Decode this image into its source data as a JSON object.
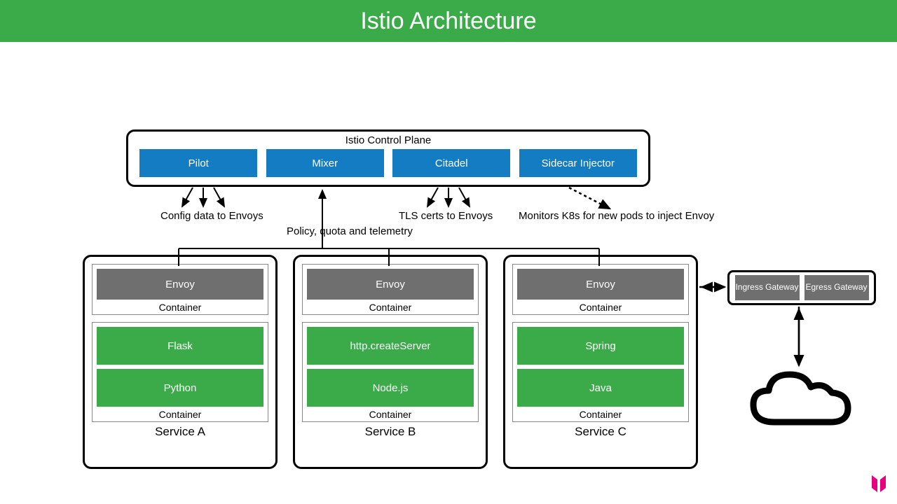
{
  "title": "Istio Architecture",
  "control_plane": {
    "label": "Istio Control Plane",
    "boxes": [
      "Pilot",
      "Mixer",
      "Citadel",
      "Sidecar Injector"
    ]
  },
  "annotations": {
    "pilot": "Config data to Envoys",
    "mixer": "Policy, quota and telemetry",
    "citadel": "TLS certs to Envoys",
    "sidecar": "Monitors K8s for new pods to inject Envoy"
  },
  "services": [
    {
      "name": "Service A",
      "envoy": "Envoy",
      "container_label": "Container",
      "app": [
        "Flask",
        "Python"
      ]
    },
    {
      "name": "Service B",
      "envoy": "Envoy",
      "container_label": "Container",
      "app": [
        "http.createServer",
        "Node.js"
      ]
    },
    {
      "name": "Service C",
      "envoy": "Envoy",
      "container_label": "Container",
      "app": [
        "Spring",
        "Java"
      ]
    }
  ],
  "gateways": {
    "ingress": "Ingress Gateway",
    "egress": "Egress Gateway"
  },
  "colors": {
    "green": "#3bab49",
    "blue": "#137cc2",
    "grey": "#6f6f6f"
  }
}
